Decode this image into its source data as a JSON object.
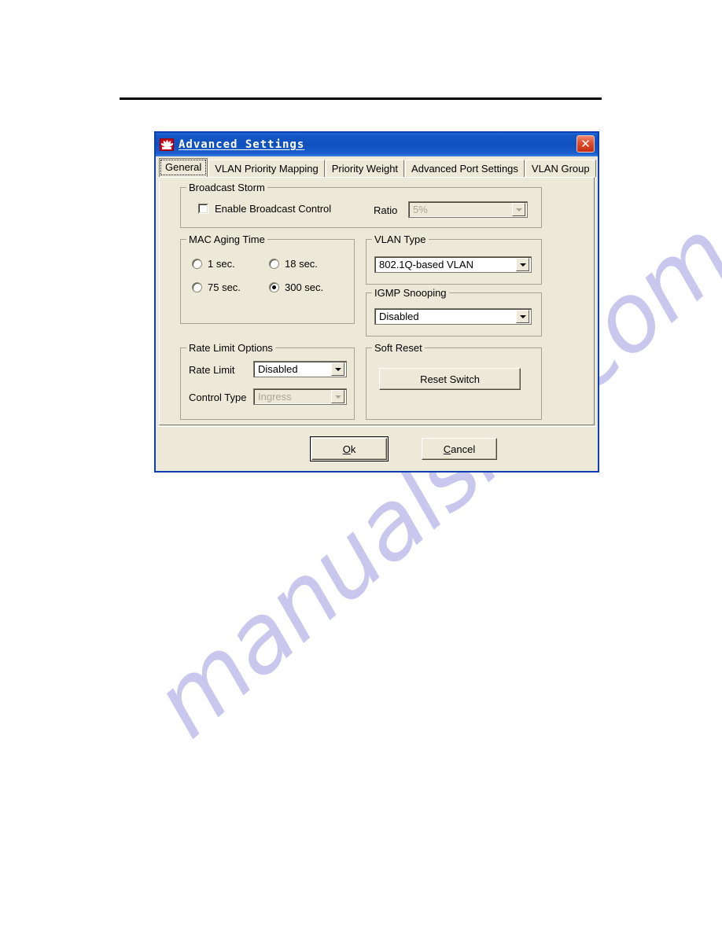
{
  "page": {
    "watermark_text": "manualslib.com",
    "rule_color": "#000000"
  },
  "dialog": {
    "title": "Advanced Settings",
    "logo_name": "huawei-logo",
    "close_label": "✕",
    "accent_color": "#0c3fb5",
    "face_color": "#ece9d8"
  },
  "tabs": [
    {
      "label": "General",
      "active": true
    },
    {
      "label": "VLAN Priority Mapping",
      "active": false
    },
    {
      "label": "Priority Weight",
      "active": false
    },
    {
      "label": "Advanced Port Settings",
      "active": false
    },
    {
      "label": "VLAN Group",
      "active": false
    }
  ],
  "broadcast_storm": {
    "title": "Broadcast Storm",
    "enable_label": "Enable Broadcast Control",
    "enable_checked": false,
    "ratio_label": "Ratio",
    "ratio_value": "5%",
    "ratio_disabled": true
  },
  "mac_aging_time": {
    "title": "MAC Aging Time",
    "options": [
      {
        "label": "1 sec.",
        "selected": false
      },
      {
        "label": "18 sec.",
        "selected": false
      },
      {
        "label": "75 sec.",
        "selected": false
      },
      {
        "label": "300 sec.",
        "selected": true
      }
    ]
  },
  "vlan_type": {
    "title": "VLAN Type",
    "value": "802.1Q-based VLAN"
  },
  "igmp_snooping": {
    "title": "IGMP Snooping",
    "value": "Disabled"
  },
  "rate_limit_options": {
    "title": "Rate Limit Options",
    "rate_limit_label": "Rate Limit",
    "rate_limit_value": "Disabled",
    "control_type_label": "Control Type",
    "control_type_value": "Ingress",
    "control_type_disabled": true
  },
  "soft_reset": {
    "title": "Soft Reset",
    "button_label": "Reset Switch"
  },
  "footer": {
    "ok_accel": "O",
    "ok_rest": "k",
    "cancel_accel": "C",
    "cancel_rest": "ancel"
  }
}
